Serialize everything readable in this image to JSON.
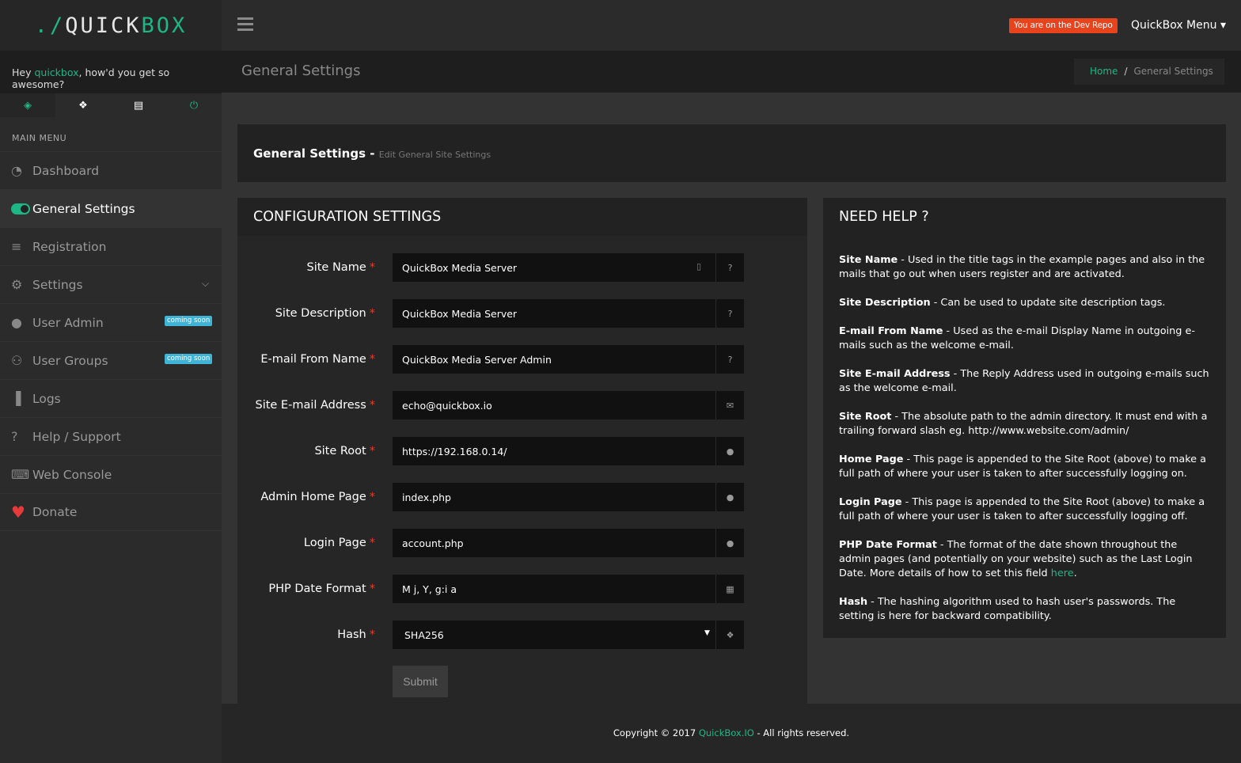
{
  "brand": {
    "prefix": "./",
    "quick": "QUICK",
    "box_b": "B",
    "box_rest": "OX",
    "colors": {
      "accent": "#1db785",
      "badge": "#e8431c"
    }
  },
  "header": {
    "dev_badge": "You are on the Dev Repo",
    "menu_label": "QuickBox Menu ▾"
  },
  "greeting": {
    "before": "Hey ",
    "user": "quickbox",
    "after": ", how'd you get so awesome?"
  },
  "side_tabs": [
    {
      "icon": "diamond-icon",
      "glyph": "◈"
    },
    {
      "icon": "cubes-icon",
      "glyph": "❖"
    },
    {
      "icon": "id-card-icon",
      "glyph": "▤"
    },
    {
      "icon": "power-icon",
      "glyph": "⏻"
    }
  ],
  "sidebar": {
    "menu_label": "MAIN MENU",
    "items": [
      {
        "label": "Dashboard",
        "icon": "dashboard-icon",
        "glyph": "◔"
      },
      {
        "label": "General Settings",
        "icon": "toggle-icon",
        "glyph": ""
      },
      {
        "label": "Registration",
        "icon": "server-icon",
        "glyph": "≡"
      },
      {
        "label": "Settings",
        "icon": "cogs-icon",
        "glyph": "⚙",
        "chevron": "⌵"
      },
      {
        "label": "User Admin",
        "icon": "user-circle-icon",
        "glyph": "●",
        "badge": "coming soon"
      },
      {
        "label": "User Groups",
        "icon": "users-icon",
        "glyph": "⚇",
        "badge": "coming soon"
      },
      {
        "label": "Logs",
        "icon": "bar-chart-icon",
        "glyph": "▐"
      },
      {
        "label": "Help / Support",
        "icon": "question-circle-icon",
        "glyph": "?"
      },
      {
        "label": "Web Console",
        "icon": "keyboard-icon",
        "glyph": "⌨"
      },
      {
        "label": "Donate",
        "icon": "heart-icon",
        "glyph": "♥"
      }
    ]
  },
  "page": {
    "title": "General Settings",
    "breadcrumb": {
      "home": "Home",
      "sep": "/",
      "current": "General Settings"
    }
  },
  "title_panel": {
    "title": "General Settings - ",
    "subtitle": "Edit General Site Settings"
  },
  "config": {
    "heading": "CONFIGURATION SETTINGS",
    "fields": [
      {
        "label": "Site Name",
        "value": "QuickBox Media Server",
        "addon": "question-circle-icon",
        "glyph": "?"
      },
      {
        "label": "Site Description",
        "value": "QuickBox Media Server",
        "addon": "question-circle-icon",
        "glyph": "?"
      },
      {
        "label": "E-mail From Name",
        "value": "QuickBox Media Server Admin",
        "addon": "question-circle-icon",
        "glyph": "?"
      },
      {
        "label": "Site E-mail Address",
        "value": "echo@quickbox.io",
        "addon": "envelope-icon",
        "glyph": "✉"
      },
      {
        "label": "Site Root",
        "value": "https://192.168.0.14/",
        "addon": "globe-icon",
        "glyph": "●"
      },
      {
        "label": "Admin Home Page",
        "value": "index.php",
        "addon": "globe-icon",
        "glyph": "●"
      },
      {
        "label": "Login Page",
        "value": "account.php",
        "addon": "globe-icon",
        "glyph": "●"
      },
      {
        "label": "PHP Date Format",
        "value": "M j, Y, g:i a",
        "addon": "calendar-icon",
        "glyph": "▦"
      },
      {
        "label": "Hash",
        "value": "SHA256",
        "addon": "puzzle-icon",
        "glyph": "❖"
      }
    ],
    "required_mark": "*",
    "submit": "Submit"
  },
  "help": {
    "heading": "NEED HELP ?",
    "items": [
      {
        "term": "Site Name",
        "text": " - Used in the title tags in the example pages and also in the mails that go out when users register and are activated."
      },
      {
        "term": "Site Description",
        "text": " - Can be used to update site description tags."
      },
      {
        "term": "E-mail From Name",
        "text": " - Used as the e-mail Display Name in outgoing e-mails such as the welcome e-mail."
      },
      {
        "term": "Site E-mail Address",
        "text": " - The Reply Address used in outgoing e-mails such as the welcome e-mail."
      },
      {
        "term": "Site Root",
        "text": " - The absolute path to the admin directory. It must end with a trailing forward slash eg. http://www.website.com/admin/"
      },
      {
        "term": "Home Page",
        "text": " - This page is appended to the Site Root (above) to make a full path of where your user is taken to after successfully logging on."
      },
      {
        "term": "Login Page",
        "text": " - This page is appended to the Site Root (above) to make a full path of where your user is taken to after successfully logging off."
      },
      {
        "term": "PHP Date Format",
        "text": " - The format of the date shown throughout the admin pages (and potentially on your website) such as the Last Login Date. More details of how to set this field ",
        "link": "here",
        "tail": "."
      },
      {
        "term": "Hash",
        "text": " - The hashing algorithm used to hash user's passwords. The setting is here for backward compatibility."
      }
    ]
  },
  "footer": {
    "before": "Copyright © 2017 ",
    "brand": "QuickBox.IO",
    "after": " - All rights reserved."
  }
}
